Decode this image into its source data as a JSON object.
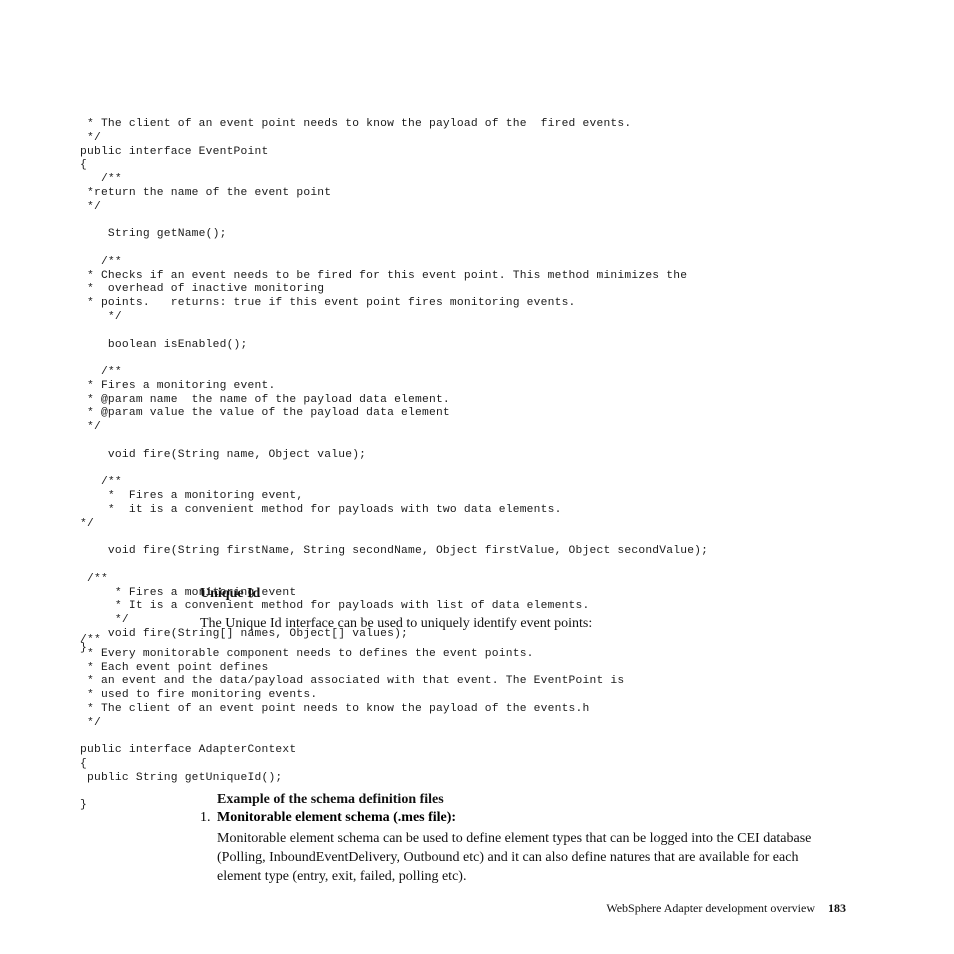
{
  "code_block_1": " * The client of an event point needs to know the payload of the  fired events.\n */\npublic interface EventPoint\n{\n   /**\n *return the name of the event point\n */\n\n    String getName();\n\n   /**\n * Checks if an event needs to be fired for this event point. This method minimizes the\n *  overhead of inactive monitoring\n * points.   returns: true if this event point fires monitoring events.\n    */\n\n    boolean isEnabled();\n\n   /**\n * Fires a monitoring event.\n * @param name  the name of the payload data element.\n * @param value the value of the payload data element\n */\n\n    void fire(String name, Object value);\n\n   /**\n    *  Fires a monitoring event,\n    *  it is a convenient method for payloads with two data elements.\n*/\n\n    void fire(String firstName, String secondName, Object firstValue, Object secondValue);\n\n /**\n     * Fires a monitoring event\n     * It is a convenient method for payloads with list of data elements.\n     */\n    void fire(String[] names, Object[] values);\n}",
  "section_heading": "Unique Id",
  "section_desc": "The Unique Id interface can be used to uniquely identify event points:",
  "code_block_2": "/**\n * Every monitorable component needs to defines the event points.\n * Each event point defines\n * an event and the data/payload associated with that event. The EventPoint is\n * used to fire monitoring events.\n * The client of an event point needs to know the payload of the events.h\n */\n\npublic interface AdapterContext\n{\n public String getUniqueId();\n\n}",
  "example_heading": "Example of the schema definition files",
  "list_number": "1.",
  "list_label": "Monitorable element schema (.mes file):",
  "list_body": "Monitorable element schema can be used to define element types that can be logged into the CEI database (Polling, InboundEventDelivery, Outbound etc) and it can also define natures that are available for each element type (entry, exit, failed, polling etc).",
  "footer_text": "WebSphere Adapter development overview",
  "footer_page": "183"
}
